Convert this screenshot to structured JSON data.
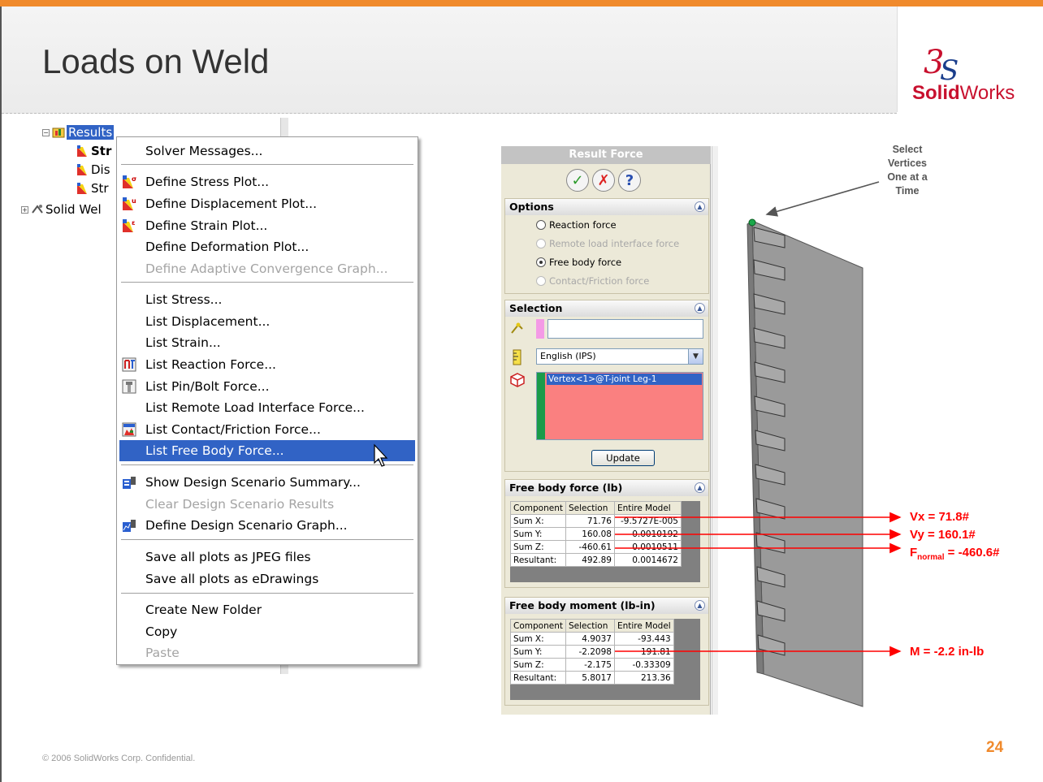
{
  "slide": {
    "title": "Loads on Weld",
    "logo": "SolidWorks",
    "footer": "© 2006 SolidWorks Corp. Confidential.",
    "page_number": "24"
  },
  "tree": {
    "results_label": "Results",
    "child_1": "Str",
    "child_2": "Dis",
    "child_3": "Str",
    "solid_weld": "Solid Wel"
  },
  "menu": {
    "items": [
      {
        "label": "Solver Messages...",
        "disabled": false
      },
      {
        "label": "Define Stress Plot...",
        "disabled": false
      },
      {
        "label": "Define Displacement Plot...",
        "disabled": false
      },
      {
        "label": "Define Strain Plot...",
        "disabled": false
      },
      {
        "label": "Define Deformation Plot...",
        "disabled": false
      },
      {
        "label": "Define Adaptive Convergence Graph...",
        "disabled": true
      },
      {
        "label": "List Stress...",
        "disabled": false
      },
      {
        "label": "List Displacement...",
        "disabled": false
      },
      {
        "label": "List Strain...",
        "disabled": false
      },
      {
        "label": "List Reaction Force...",
        "disabled": false
      },
      {
        "label": "List Pin/Bolt Force...",
        "disabled": false
      },
      {
        "label": "List Remote Load Interface Force...",
        "disabled": false
      },
      {
        "label": "List Contact/Friction Force...",
        "disabled": false
      },
      {
        "label": "List Free Body Force...",
        "disabled": false,
        "selected": true
      },
      {
        "label": "Show Design Scenario Summary...",
        "disabled": false
      },
      {
        "label": "Clear Design Scenario Results",
        "disabled": true
      },
      {
        "label": "Define Design Scenario Graph...",
        "disabled": false
      },
      {
        "label": "Save all plots as JPEG files",
        "disabled": false
      },
      {
        "label": "Save all plots as eDrawings",
        "disabled": false
      },
      {
        "label": "Create New Folder",
        "disabled": false
      },
      {
        "label": "Copy",
        "disabled": false
      },
      {
        "label": "Paste",
        "disabled": true
      }
    ]
  },
  "property_manager": {
    "title": "Result Force",
    "options": {
      "header": "Options",
      "radios": [
        {
          "label": "Reaction force",
          "checked": false,
          "disabled": false
        },
        {
          "label": "Remote load interface force",
          "checked": false,
          "disabled": true
        },
        {
          "label": "Free body force",
          "checked": true,
          "disabled": false
        },
        {
          "label": "Contact/Friction force",
          "checked": false,
          "disabled": true
        }
      ]
    },
    "selection": {
      "header": "Selection",
      "input_value": "",
      "units": "English (IPS)",
      "selected_entity": "Vertex<1>@T-joint Leg-1",
      "update_button": "Update"
    },
    "free_body_force": {
      "header": "Free body force (lb)",
      "columns": [
        "Component",
        "Selection",
        "Entire Model"
      ],
      "rows": [
        [
          "Sum X:",
          "71.76",
          "-9.5727E-005"
        ],
        [
          "Sum Y:",
          "160.08",
          "0.0010192"
        ],
        [
          "Sum Z:",
          "-460.61",
          "0.0010511"
        ],
        [
          "Resultant:",
          "492.89",
          "0.0014672"
        ]
      ]
    },
    "free_body_moment": {
      "header": "Free body moment (lb-in)",
      "columns": [
        "Component",
        "Selection",
        "Entire Model"
      ],
      "rows": [
        [
          "Sum X:",
          "4.9037",
          "-93.443"
        ],
        [
          "Sum Y:",
          "-2.2098",
          "191.81"
        ],
        [
          "Sum Z:",
          "-2.175",
          "-0.33309"
        ],
        [
          "Resultant:",
          "5.8017",
          "213.36"
        ]
      ]
    }
  },
  "annotations": {
    "callout_line1": "Select",
    "callout_line2": "Vertices",
    "callout_line3": "One at a",
    "callout_line4": "Time",
    "vx": "Vx = 71.8#",
    "vy": "Vy = 160.1#",
    "fnormal_f": "F",
    "fnormal_sub": "normal",
    "fnormal_val": " = -460.6#",
    "moment": "M = -2.2 in-lb"
  },
  "colors": {
    "accent_orange": "#f08a2c",
    "highlight_blue": "#3163c5",
    "annotation_red": "#ff0000"
  }
}
